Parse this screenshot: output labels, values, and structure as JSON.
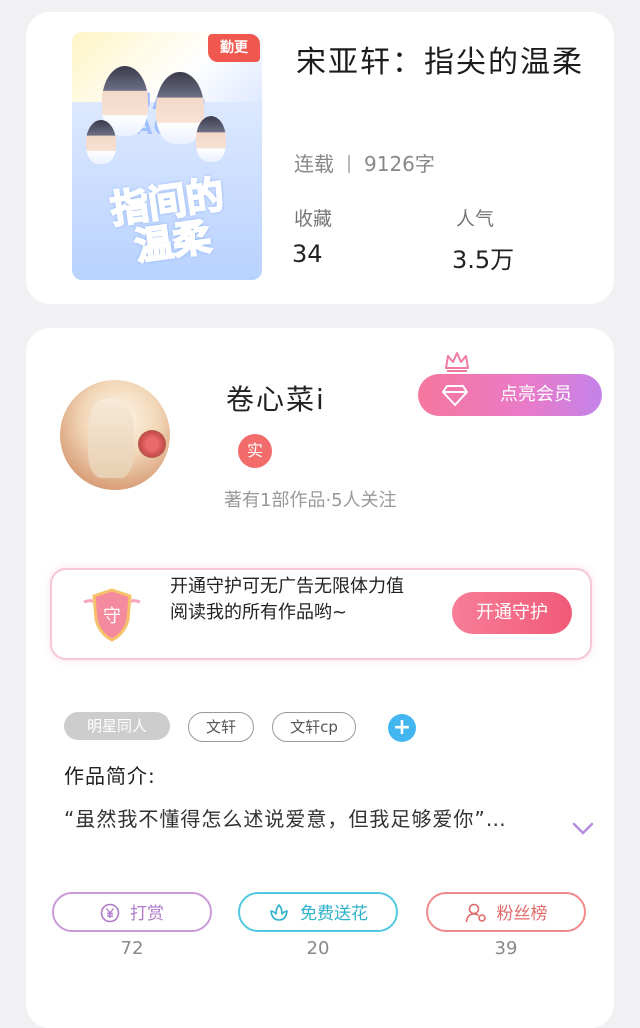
{
  "book": {
    "update_tag": "勤更",
    "title": "宋亚轩：指尖的温柔",
    "status": "连载",
    "word_count": "9126字",
    "stats": [
      {
        "label": "收藏",
        "value": "34"
      },
      {
        "label": "人气",
        "value": "3.5万"
      }
    ]
  },
  "author": {
    "name": "卷心菜i",
    "verified_label": "实",
    "info": "著有1部作品·5人关注",
    "vip_button": "点亮会员",
    "guard": {
      "text": "开通守护可无广告无限体力值阅读我的所有作品哟~",
      "shield_label": "守",
      "button": "开通守护"
    }
  },
  "tags": [
    "明星同人",
    "文轩",
    "文轩cp"
  ],
  "add_tag_label": "+",
  "intro": {
    "title": "作品简介:",
    "text": "“虽然我不懂得怎么述说爱意，但我足够爱你”…"
  },
  "actions": [
    {
      "label": "打赏",
      "count": "72",
      "icon": "yen-icon",
      "color": "#c89ad8"
    },
    {
      "label": "免费送花",
      "count": "20",
      "icon": "flower-icon",
      "color": "#4fc9e0"
    },
    {
      "label": "粉丝榜",
      "count": "39",
      "icon": "user-icon",
      "color": "#f08a8a"
    }
  ],
  "colors": {
    "accent_red": "#f0584f",
    "vip_gradient_start": "#f7779d",
    "vip_gradient_end": "#c383ea",
    "tag_add": "#43b6ef"
  }
}
